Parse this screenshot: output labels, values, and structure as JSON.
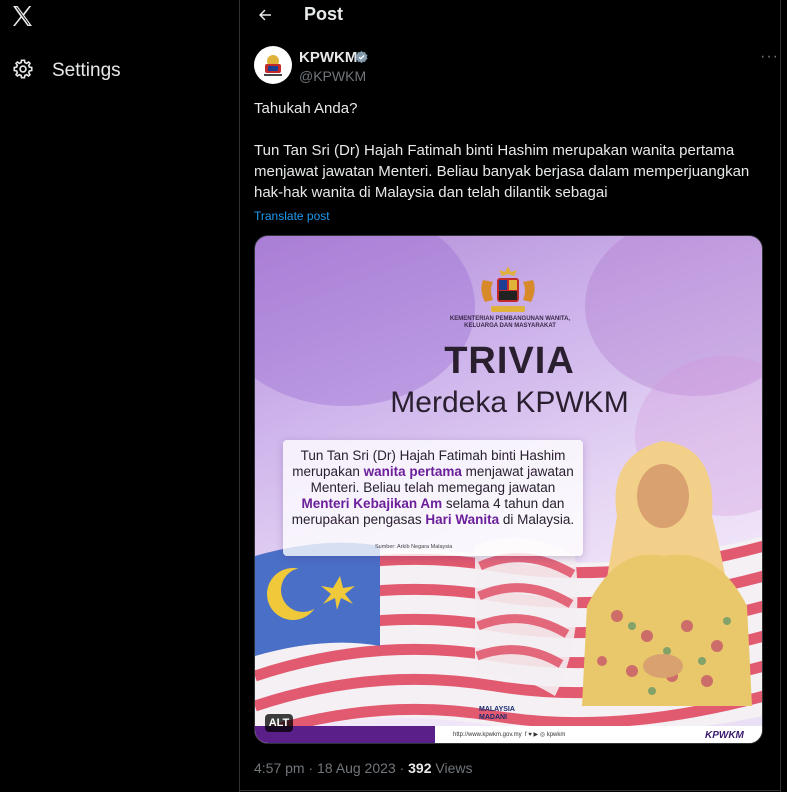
{
  "sidebar": {
    "logo_icon": "x-logo-icon",
    "settings_label": "Settings",
    "settings_icon": "gear-icon"
  },
  "header": {
    "title": "Post",
    "back_icon": "arrow-left-icon"
  },
  "post": {
    "author": {
      "display_name": "KPWKM",
      "handle": "@KPWKM",
      "verified": true
    },
    "more_icon": "ellipsis-icon",
    "more_label": "···",
    "text_line1": "Tahukah Anda?",
    "text_para2": "Tun Tan Sri (Dr) Hajah Fatimah binti Hashim merupakan wanita pertama menjawat jawatan Menteri. Beliau banyak berjasa dalam memperjuangkan hak-hak wanita di Malaysia dan telah dilantik sebagai",
    "translate_label": "Translate post",
    "time": "4:57 pm",
    "separator": "·",
    "date": "18 Aug 2023",
    "views_count": "392",
    "views_label": "Views"
  },
  "media": {
    "alt_badge": "ALT",
    "ministry_line1": "KEMENTERIAN PEMBANGUNAN WANITA,",
    "ministry_line2": "KELUARGA DAN MASYARAKAT",
    "headline": "TRIVIA",
    "subheadline": "Merdeka KPWKM",
    "info_part1": "Tun Tan Sri (Dr) Hajah Fatimah binti Hashim merupakan ",
    "info_hl1": "wanita pertama",
    "info_part2": " menjawat jawatan Menteri. Beliau telah memegang jawatan ",
    "info_hl2": "Menteri Kebajikan Am",
    "info_part3": " selama 4 tahun dan merupakan pengasas ",
    "info_hl3": "Hari Wanita",
    "info_part4": " di Malaysia.",
    "source": "Sumber: Arkib Negara Malaysia",
    "madani_line1": "MALAYSIA",
    "madani_line2": "MADANI",
    "url": "http://www.kpwkm.gov.my",
    "social_handle": "kpwkm",
    "tag": "KPWKM"
  },
  "colors": {
    "background": "#000000",
    "text": "#e7e9ea",
    "muted": "#71767b",
    "link": "#1d9bf0",
    "verified": "#829aab",
    "highlight": "#6b1f9a"
  }
}
